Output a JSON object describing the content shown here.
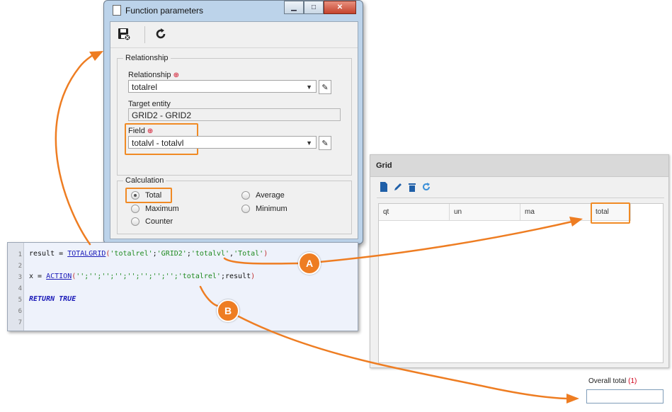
{
  "dialog": {
    "title": "Function parameters",
    "window_buttons": {
      "minimize": "▁",
      "maximize": "□",
      "close": "✕"
    },
    "toolbar": {
      "save_icon": "save-close-icon",
      "refresh_icon": "refresh-icon"
    },
    "relationship_group": {
      "legend": "Relationship",
      "relationship_label": "Relationship",
      "relationship_value": "totalrel",
      "target_entity_label": "Target entity",
      "target_entity_value": "GRID2 - GRID2",
      "field_label": "Field",
      "field_value": "totalvl - totalvl"
    },
    "calculation_group": {
      "legend": "Calculation",
      "options": [
        "Total",
        "Maximum",
        "Counter",
        "Average",
        "Minimum"
      ],
      "selected": "Total"
    }
  },
  "code": {
    "line_numbers": [
      "1",
      "2",
      "3",
      "4",
      "5",
      "6",
      "7"
    ],
    "line1": {
      "var": "result = ",
      "fn": "TOTALGRID",
      "open": "(",
      "a1": "'totalrel'",
      "s1": ";",
      "a2": "'GRID2'",
      "s2": ";",
      "a3": "'totalvl'",
      "s3": ",",
      "a4": "'Total'",
      "close": ")"
    },
    "line3": {
      "var": "x = ",
      "fn": "ACTION",
      "open": "(",
      "empties": "'';'';'';'';'';'';'';'';",
      "a1": "'totalrel'",
      "rest": ";result",
      "close": ")"
    },
    "line5": "RETURN TRUE"
  },
  "grid": {
    "title": "Grid",
    "toolbar_icons": [
      "new-document-icon",
      "edit-pencil-icon",
      "delete-trash-icon",
      "refresh-icon"
    ],
    "columns": [
      "qt",
      "un",
      "ma",
      "total"
    ]
  },
  "overall_total": {
    "label": "Overall total",
    "count": "(1)",
    "value": ""
  },
  "annotations": {
    "a": "A",
    "b": "B"
  },
  "colors": {
    "accent": "#ee7d22",
    "window_frame": "#bcd3ea",
    "code_bg": "#eef2fb",
    "string": "#1f8a1f",
    "function": "#1a1ab8",
    "required": "#d0021b"
  }
}
